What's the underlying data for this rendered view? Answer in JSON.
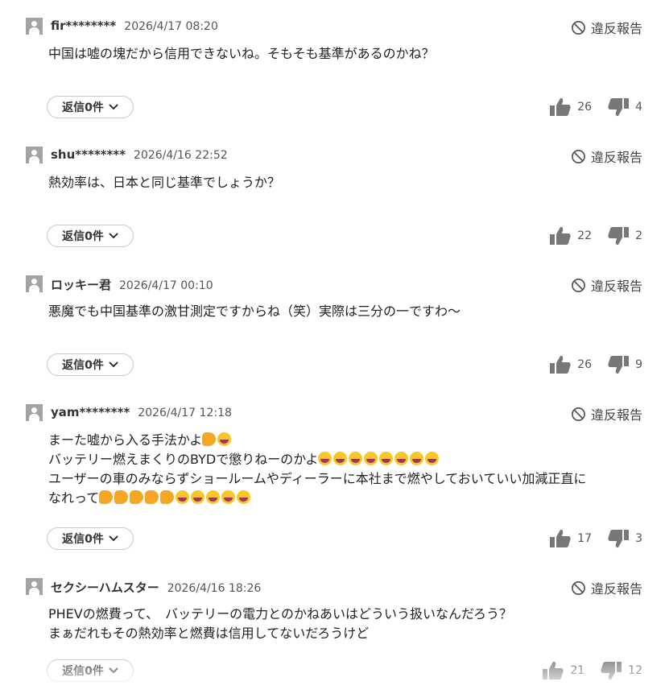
{
  "report_label": "違反報告",
  "comments": [
    {
      "username": "fir********",
      "date": "2026/4/17 08:20",
      "lines": [
        "中国は嘘の塊だから信用できないね。そもそも基準があるのかね？"
      ],
      "reply_label": "返信0件",
      "likes": "26",
      "dislikes": "4"
    },
    {
      "username": "shu********",
      "date": "2026/4/16 22:52",
      "lines": [
        "熱効率は、日本と同じ基準でしょうか？"
      ],
      "reply_label": "返信0件",
      "likes": "22",
      "dislikes": "2"
    },
    {
      "username": "ロッキー君",
      "date": "2026/4/17 00:10",
      "lines": [
        "悪魔でも中国基準の激甘測定ですからね（笑）実際は三分の一ですわ〜"
      ],
      "reply_label": "返信0件",
      "likes": "26",
      "dislikes": "9"
    },
    {
      "username": "yam********",
      "date": "2026/4/17 12:18",
      "lines": [
        "まーた嘘から入る手法かよ",
        "バッテリー燃えまくりのBYDで懲りねーのかよ",
        "ユーザーの車のみならずショールームやディーラーに本社まで燃やしておいていい加減正直に",
        "なれって"
      ],
      "emoji": {
        "line0": [
          "fist",
          "rofl"
        ],
        "line1": [
          "rofl",
          "rofl",
          "rofl",
          "rofl",
          "rofl",
          "rofl",
          "rofl",
          "rofl"
        ],
        "line3": [
          "fist",
          "fist",
          "fist",
          "fist",
          "fist",
          "rofl",
          "rofl",
          "rofl",
          "rofl",
          "rofl"
        ]
      },
      "reply_label": "返信0件",
      "likes": "17",
      "dislikes": "3"
    },
    {
      "username": "セクシーハムスター",
      "date": "2026/4/16 18:26",
      "lines": [
        "PHEVの燃費って、　バッテリーの電力とのかねあいはどういう扱いなんだろう？",
        "まぁだれもその熱効率と燃費は信用してないだろうけど"
      ],
      "reply_label": "返信0件",
      "likes": "21",
      "dislikes": "12"
    }
  ],
  "icons": [
    "avatar-icon",
    "ban-icon",
    "chevron-down-icon",
    "thumbs-up-icon",
    "thumbs-down-icon",
    "fist-emoji",
    "rofl-emoji"
  ]
}
